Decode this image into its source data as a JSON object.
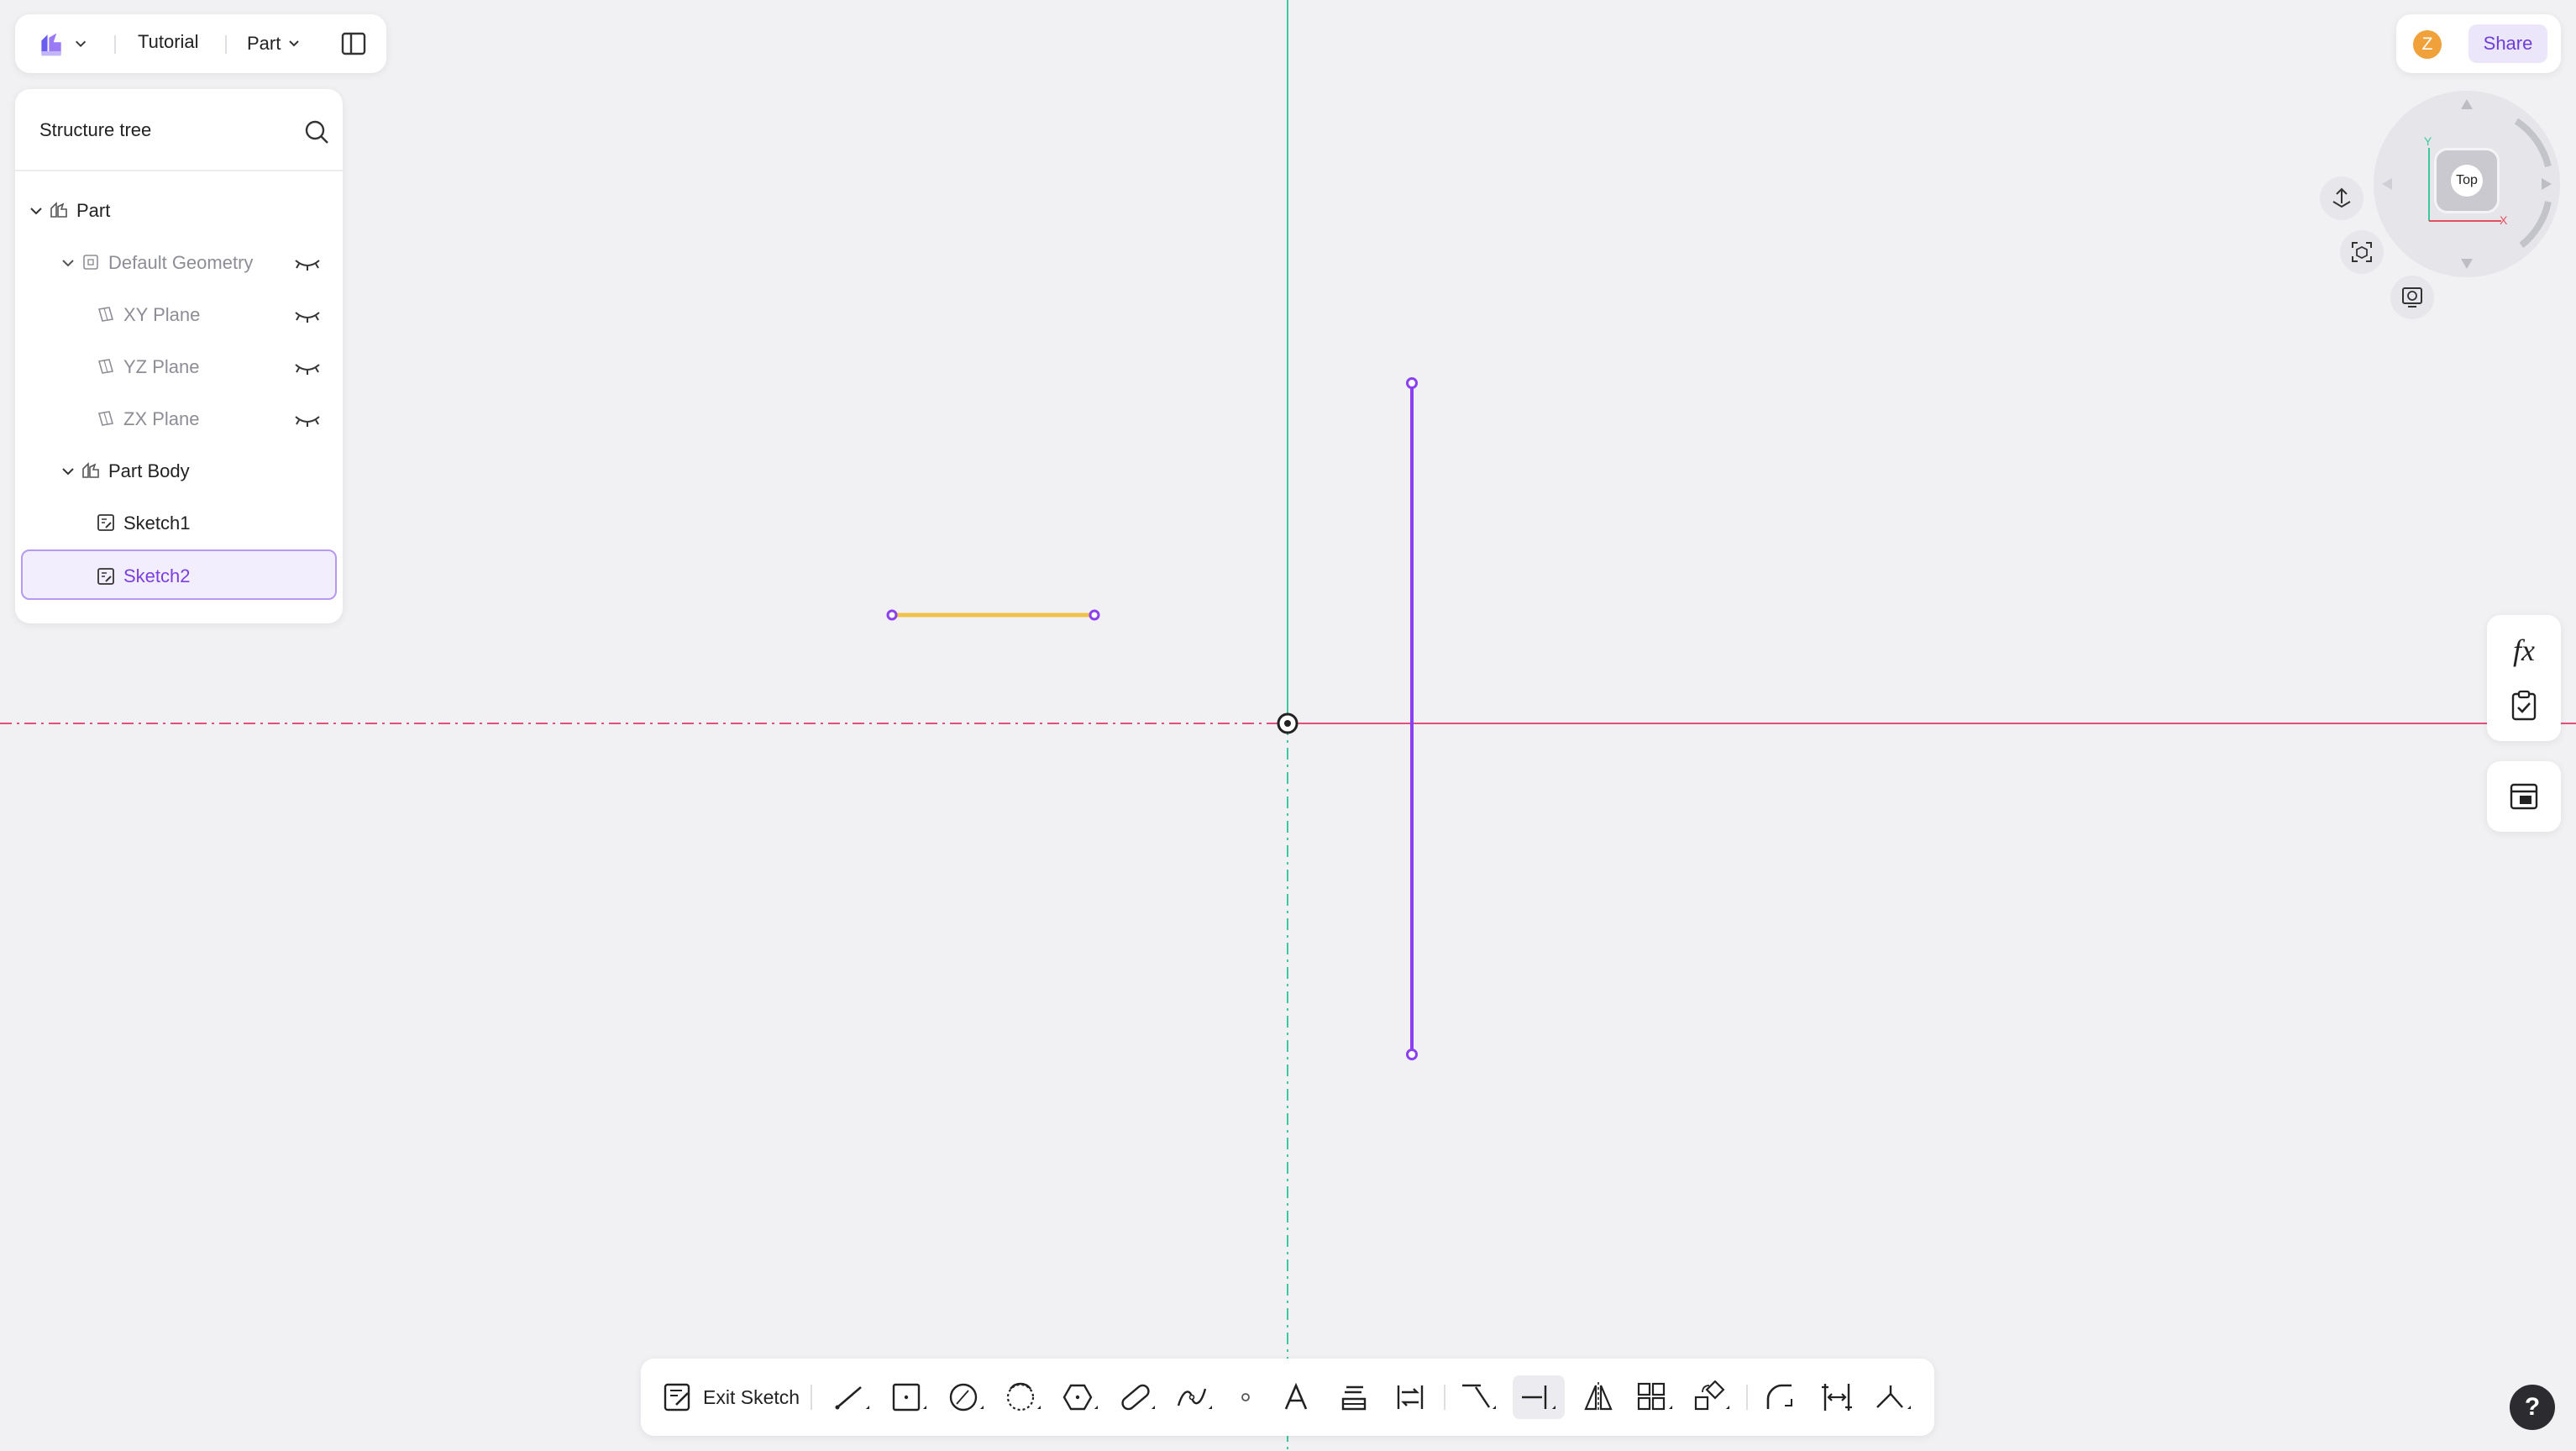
{
  "header": {
    "breadcrumb_project": "Tutorial",
    "breadcrumb_type": "Part"
  },
  "tree": {
    "title": "Structure tree",
    "items": [
      {
        "label": "Part",
        "level": 0,
        "expanded": true
      },
      {
        "label": "Default Geometry",
        "level": 1,
        "expanded": true,
        "hidden": true
      },
      {
        "label": "XY Plane",
        "level": 2,
        "hidden": true
      },
      {
        "label": "YZ Plane",
        "level": 2,
        "hidden": true
      },
      {
        "label": "ZX Plane",
        "level": 2,
        "hidden": true
      },
      {
        "label": "Part Body",
        "level": 1,
        "expanded": true
      },
      {
        "label": "Sketch1",
        "level": 2
      },
      {
        "label": "Sketch2",
        "level": 2,
        "selected": true
      }
    ]
  },
  "topright": {
    "avatar_initial": "Z",
    "share_label": "Share"
  },
  "viewcube": {
    "face_label": "Top",
    "axis_x": "X",
    "axis_y": "Y"
  },
  "side_panel": {
    "formula_label": "fx"
  },
  "toolbar": {
    "exit_label": "Exit Sketch",
    "tools": [
      "line-tool",
      "rectangle-tool",
      "circle-tool",
      "arc-tool",
      "polygon-tool",
      "slot-tool",
      "spline-tool",
      "point-tool",
      "text-tool",
      "project-tool",
      "offset-tool",
      "trim-tool",
      "split-tool",
      "mirror-tool",
      "pattern-tool",
      "transform-tool",
      "fillet-tool",
      "dimension-tool",
      "constraint-tool"
    ],
    "active_tool": "split-tool"
  },
  "help_label": "?",
  "colors": {
    "accent": "#7a3fe0",
    "sketch_line": "#8a3ff0",
    "selected_line": "#f0c24a",
    "x_axis": "#e0507a",
    "y_axis": "#3cc8a0",
    "canvas_bg": "#f1f1f3"
  }
}
